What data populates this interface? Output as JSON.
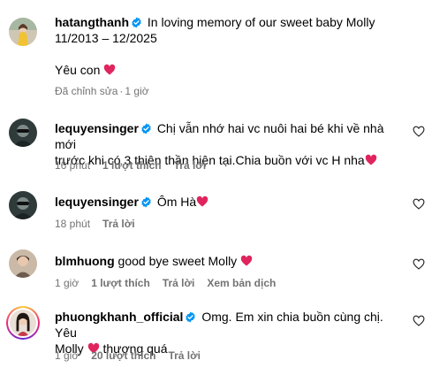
{
  "post": {
    "username": "hatangthanh",
    "caption_line1": "In loving memory of our sweet baby Molly",
    "caption_line2": "11/2013 – 12/2025",
    "caption_line3": "Yêu con",
    "edited": "Đã chỉnh sửa",
    "time": "1 giờ"
  },
  "comments": [
    {
      "username": "lequyensinger",
      "text_line1": "Chị vẫn nhớ hai vc nuôi hai bé khi về nhà mới",
      "text_line2": "trước khi có 3 thiên thần hiện tại.Chia buồn với vc H nha",
      "time": "16 phút",
      "likes": "1 lượt thích",
      "reply": "Trả lời"
    },
    {
      "username": "lequyensinger",
      "text_line1": "Ôm Hà",
      "time": "18 phút",
      "reply": "Trả lời"
    },
    {
      "username": "blmhuong",
      "text_line1": "good bye sweet Molly",
      "time": "1 giờ",
      "likes": "1 lượt thích",
      "reply": "Trả lời",
      "translate": "Xem bản dịch"
    },
    {
      "username": "phuongkhanh_official",
      "text_line1": "Omg. Em xin chia buồn cùng chị. Yêu",
      "text_line2": "Molly",
      "text_line2b": "thương quá",
      "time": "1 giờ",
      "likes": "20 lượt thích",
      "reply": "Trả lời"
    }
  ],
  "icons": {
    "verified": "verified-badge-icon",
    "heart": "heart-outline-icon",
    "emoji": "red-heart-emoji"
  },
  "colors": {
    "verified": "#0095f6",
    "meta": "#737373",
    "heart_emoji": "#e0245e"
  }
}
